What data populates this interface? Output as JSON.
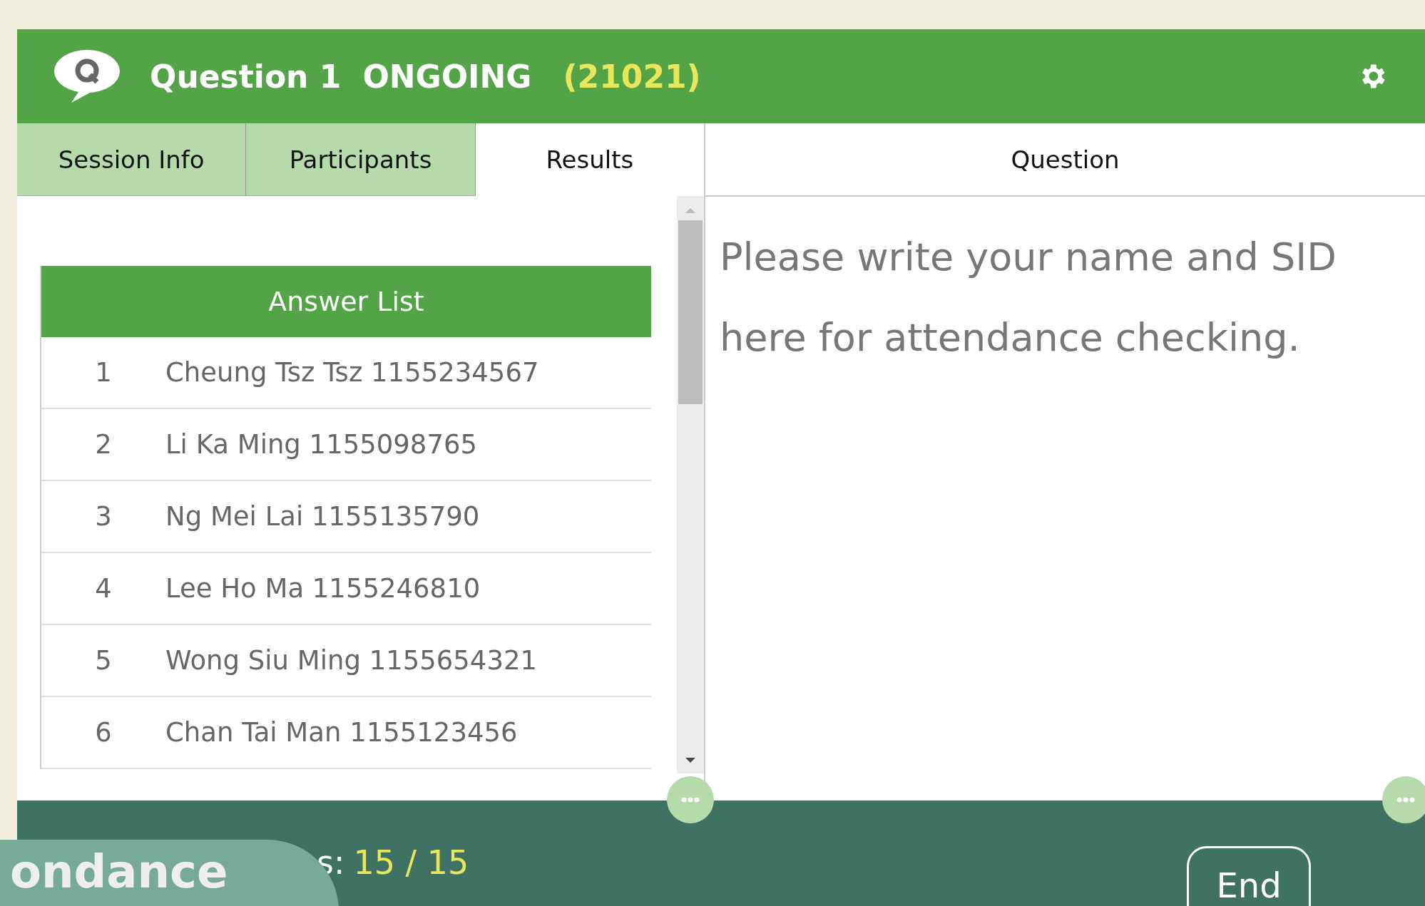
{
  "header": {
    "title": "Question 1",
    "status": "ONGOING",
    "code": "(21021)"
  },
  "tabs": [
    {
      "label": "Session Info",
      "selected": false
    },
    {
      "label": "Participants",
      "selected": false
    },
    {
      "label": "Results",
      "selected": true
    }
  ],
  "question_panel": {
    "title": "Question",
    "text": "Please write your name and SID here for attendance checking."
  },
  "answer_list": {
    "title": "Answer List",
    "rows": [
      {
        "index": "1",
        "answer": "Cheung Tsz Tsz 1155234567"
      },
      {
        "index": "2",
        "answer": "Li Ka Ming 1155098765"
      },
      {
        "index": "3",
        "answer": "Ng Mei Lai 1155135790"
      },
      {
        "index": "4",
        "answer": "Lee Ho Ma 1155246810"
      },
      {
        "index": "5",
        "answer": "Wong Siu Ming 1155654321"
      },
      {
        "index": "6",
        "answer": "Chan Tai Man 1155123456"
      }
    ]
  },
  "footer": {
    "label": "s:",
    "count": "15 / 15",
    "button": "End"
  },
  "overlay": {
    "text": "ondance"
  }
}
